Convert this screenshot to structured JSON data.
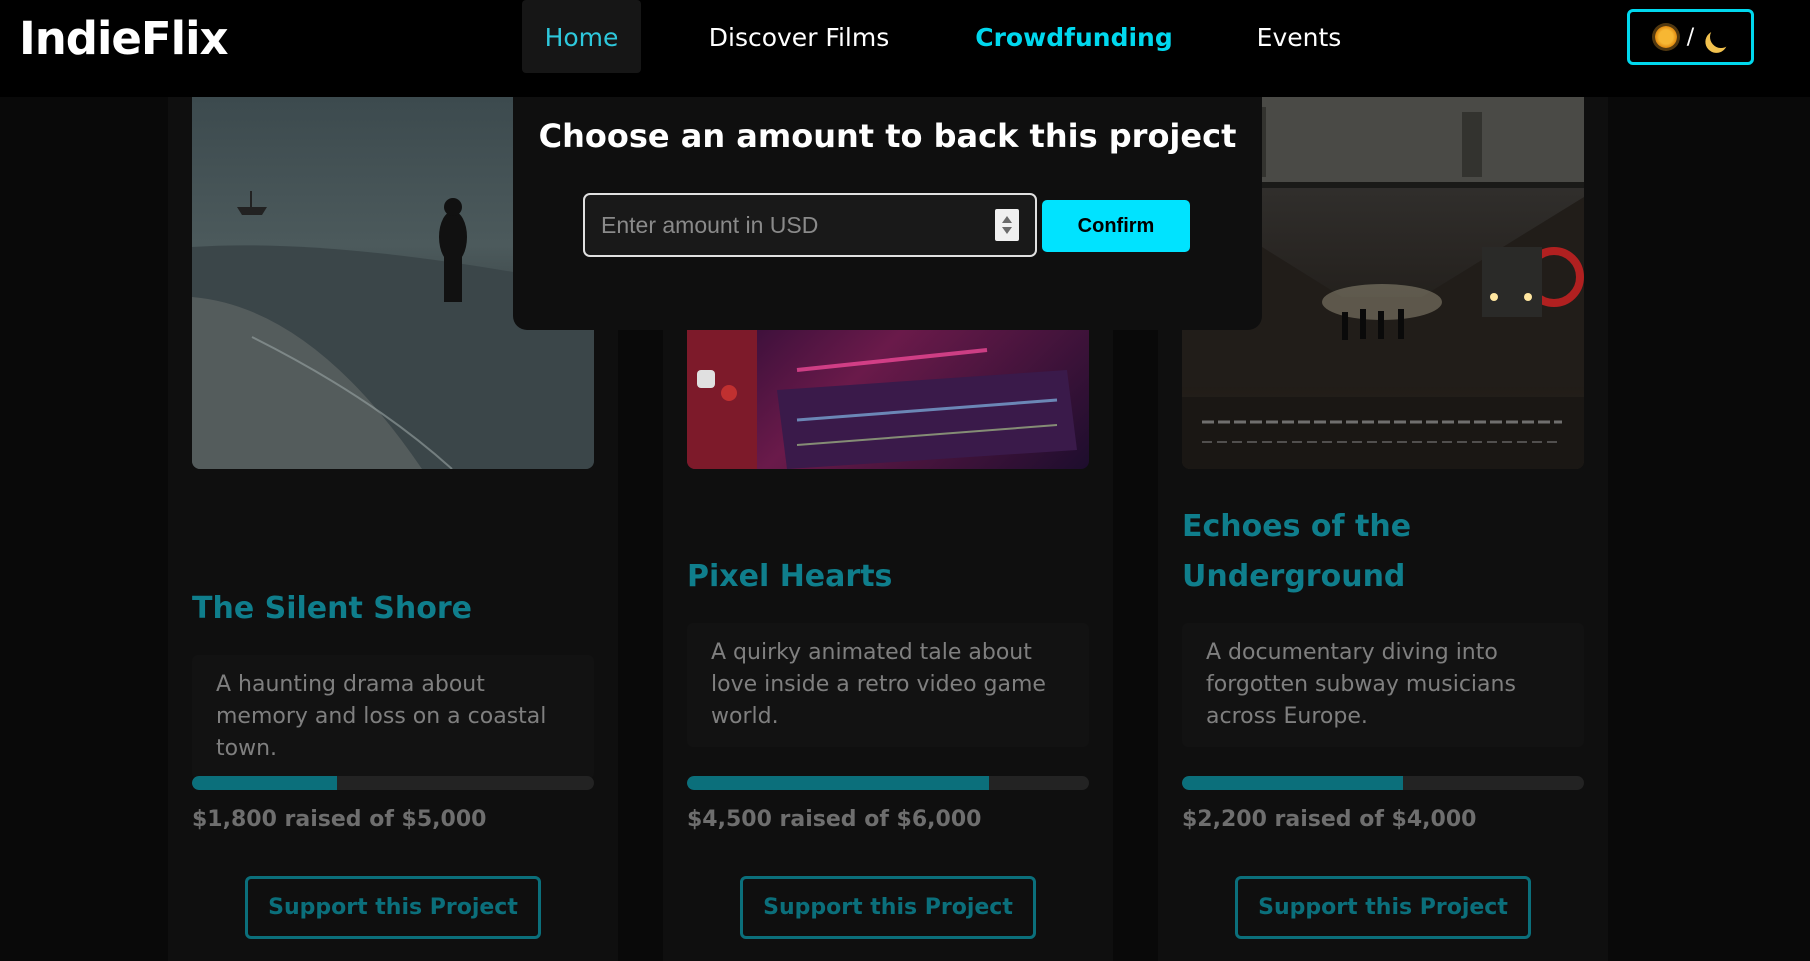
{
  "nav": {
    "logo": "IndieFlix",
    "links": [
      {
        "label": "Home",
        "active": true
      },
      {
        "label": "Discover Films"
      },
      {
        "label": "Crowdfunding",
        "current": true
      },
      {
        "label": "Events"
      }
    ],
    "theme_toggle": {
      "separator": "/",
      "icons": [
        "sun-icon",
        "moon-icon"
      ]
    }
  },
  "modal": {
    "title": "Choose an amount to back this project",
    "amount_placeholder": "Enter amount in USD",
    "confirm_label": "Confirm"
  },
  "projects": [
    {
      "title": "The Silent Shore",
      "description": "A haunting drama about memory and loss on a coastal town.",
      "raised_text": "$1,800 raised of $5,000",
      "progress": 0.36,
      "button_label": "Support this Project"
    },
    {
      "title": "Pixel Hearts",
      "description": "A quirky animated tale about love inside a retro video game world.",
      "raised_text": "$4,500 raised of $6,000",
      "progress": 0.75,
      "button_label": "Support this Project"
    },
    {
      "title": "Echoes of the Underground",
      "description": "A documentary diving into forgotten subway musicians across Europe.",
      "raised_text": "$2,200 raised of $4,000",
      "progress": 0.55,
      "button_label": "Support this Project"
    }
  ],
  "colors": {
    "accent": "#00e3ff",
    "card_accent": "#0b6f7b",
    "background": "#090909"
  }
}
